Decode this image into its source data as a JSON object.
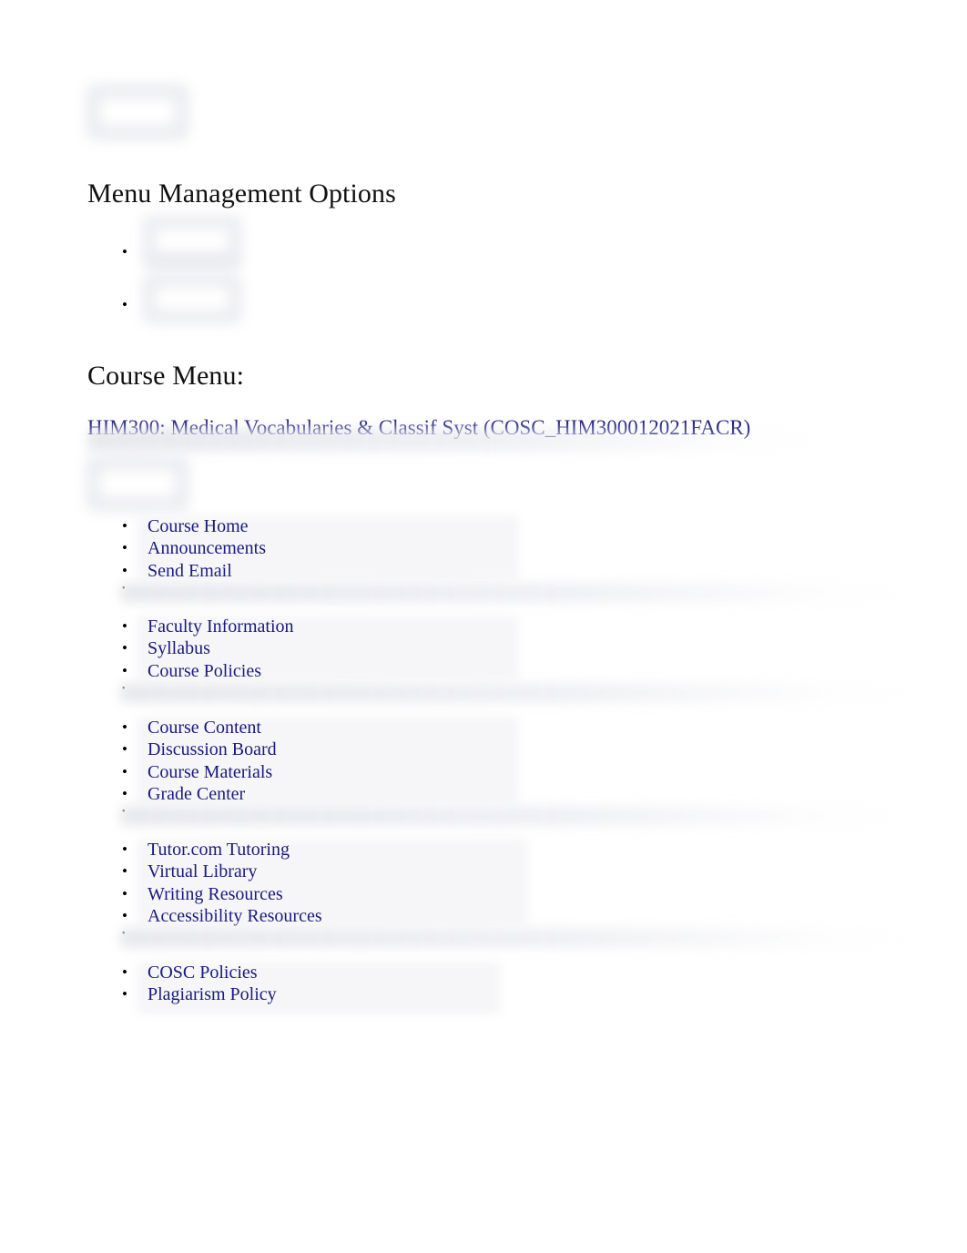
{
  "document": {
    "background_color": "#ffffff",
    "text_color": "#111111",
    "link_color": "#19197f",
    "redaction_color": "#e9eaee"
  },
  "headings": {
    "menu_management": "Menu Management Options",
    "course_menu": "Course Menu:"
  },
  "course": {
    "title": "HIM300: Medical Vocabularies & Classif Syst (COSC_HIM300012021FACR)"
  },
  "menu_management_options": [
    {
      "label": "",
      "redacted": true
    },
    {
      "label": "",
      "redacted": true
    }
  ],
  "course_menu_groups": [
    {
      "name": "communication-group",
      "items": [
        {
          "label": "Course Home"
        },
        {
          "label": "Announcements"
        },
        {
          "label": "Send Email"
        },
        {
          "label": "",
          "divider": true
        }
      ]
    },
    {
      "name": "information-group",
      "items": [
        {
          "label": "Faculty Information"
        },
        {
          "label": "Syllabus"
        },
        {
          "label": "Course Policies"
        },
        {
          "label": "",
          "divider": true
        }
      ]
    },
    {
      "name": "content-group",
      "items": [
        {
          "label": "Course Content"
        },
        {
          "label": "Discussion Board"
        },
        {
          "label": "Course Materials"
        },
        {
          "label": "Grade Center"
        },
        {
          "label": "",
          "divider": true
        }
      ]
    },
    {
      "name": "resources-group",
      "items": [
        {
          "label": "Tutor.com Tutoring"
        },
        {
          "label": "Virtual Library"
        },
        {
          "label": "Writing Resources"
        },
        {
          "label": "Accessibility Resources"
        },
        {
          "label": "",
          "divider": true
        }
      ]
    },
    {
      "name": "policies-group",
      "items": [
        {
          "label": "COSC Policies"
        },
        {
          "label": "Plagiarism Policy"
        }
      ]
    }
  ],
  "redacted_regions": [
    {
      "name": "top-toolbar-thumbnail"
    },
    {
      "name": "option-thumbnail-1"
    },
    {
      "name": "option-thumbnail-2"
    },
    {
      "name": "course-menu-thumbnail"
    },
    {
      "name": "course-title-trailing-smudge"
    }
  ]
}
